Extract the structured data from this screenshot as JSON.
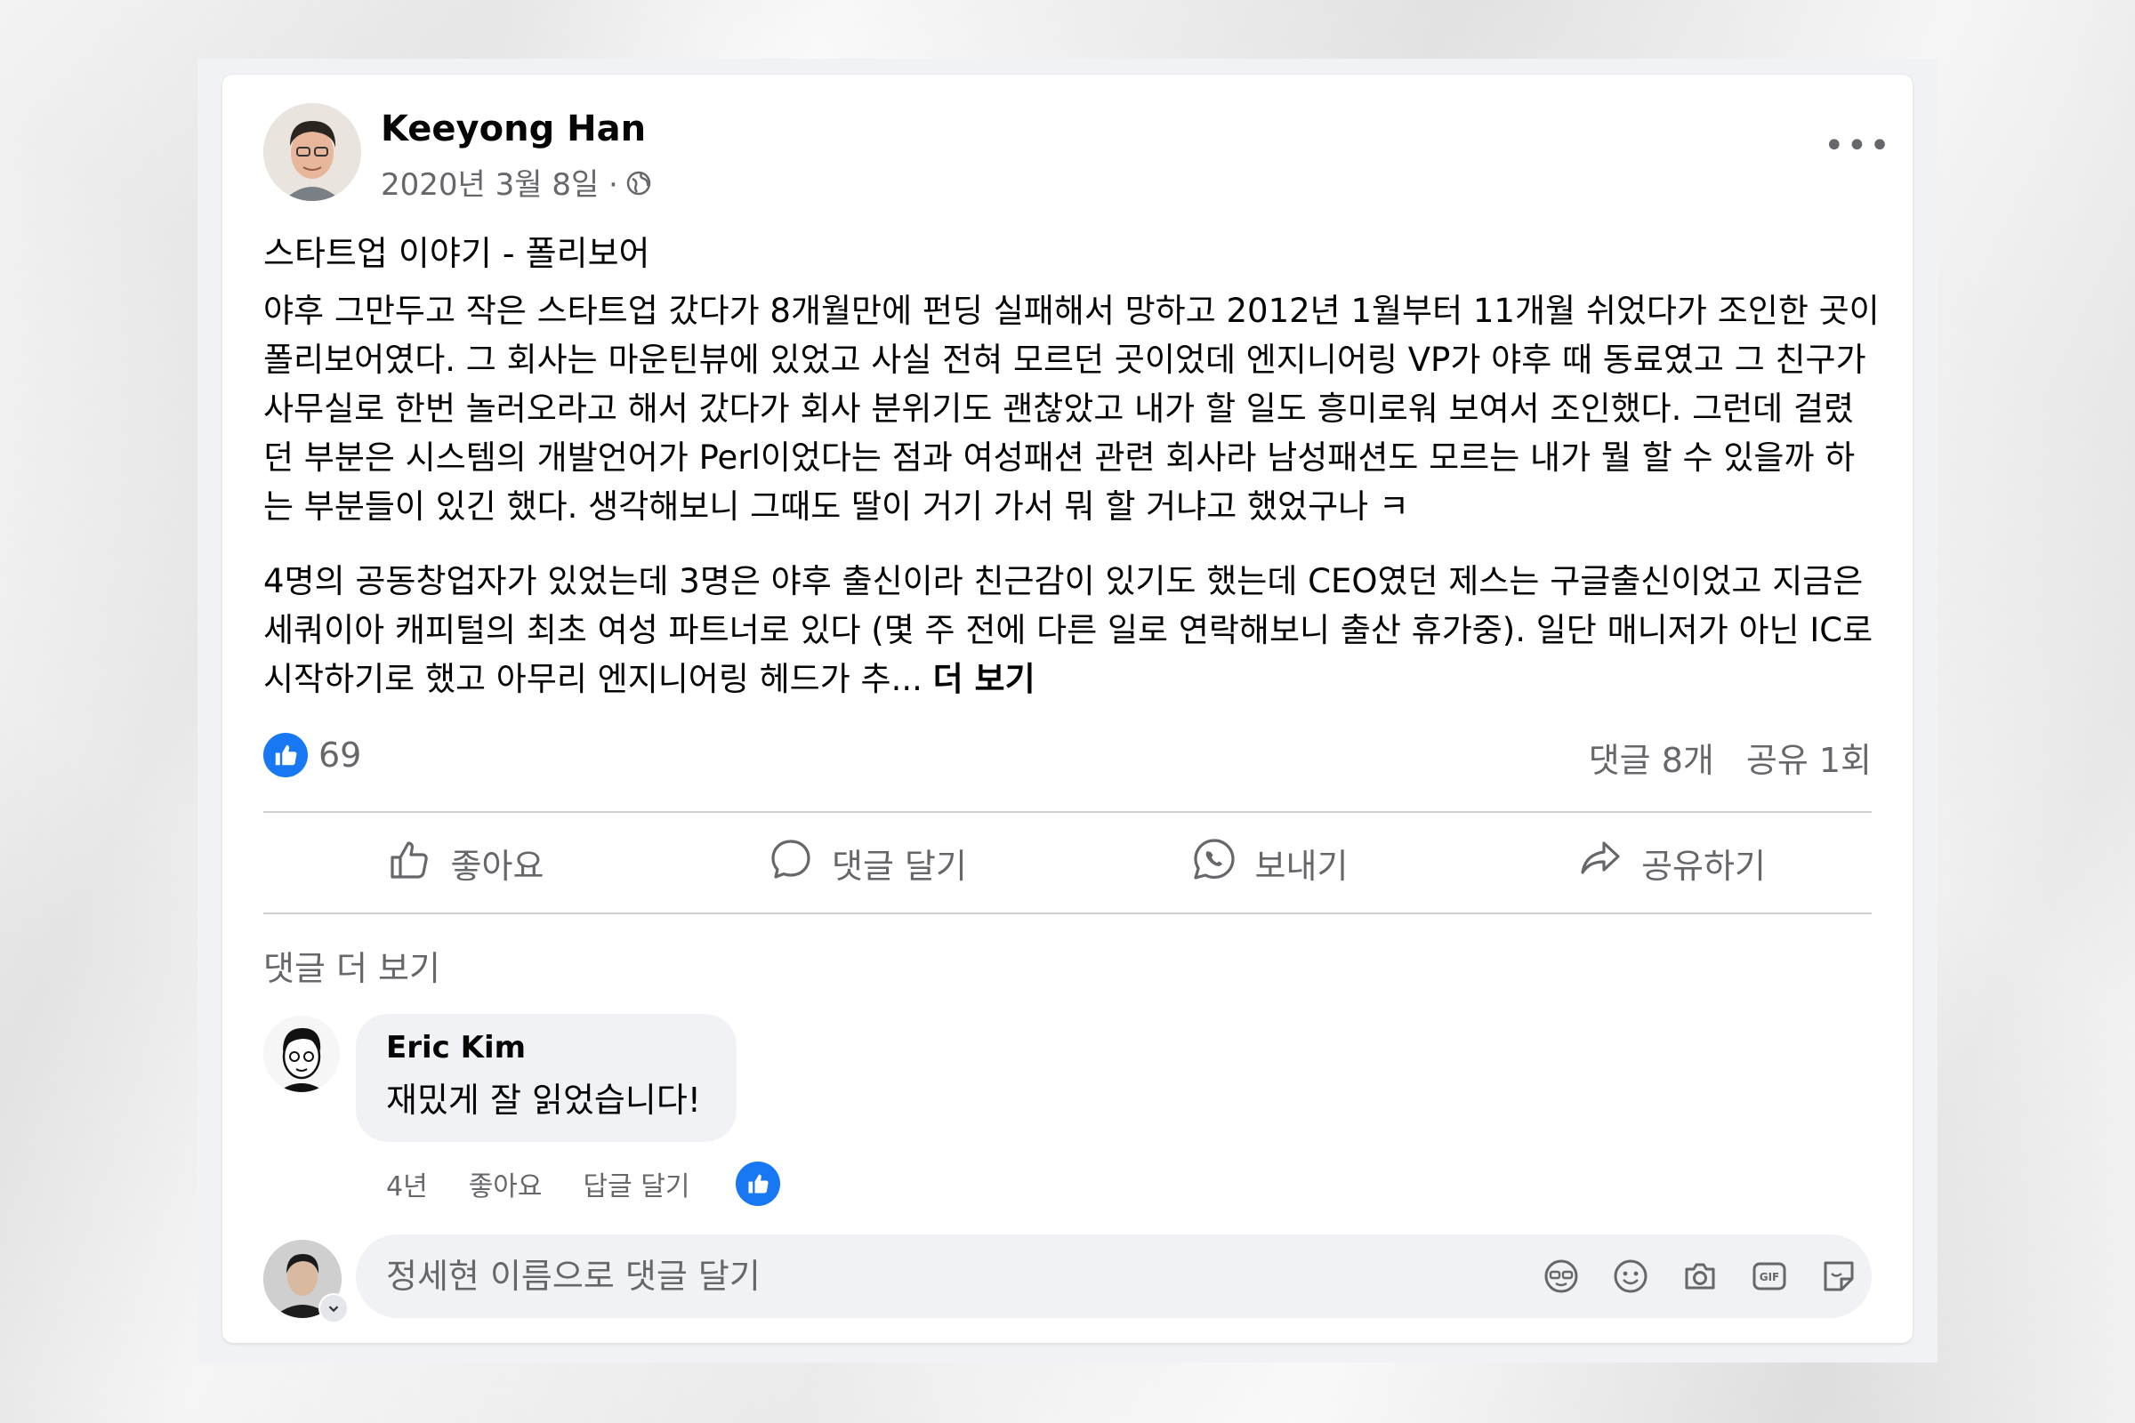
{
  "post": {
    "author": "Keeyong Han",
    "date": "2020년 3월 8일 ·",
    "title": "스타트업 이야기 - 폴리보어",
    "paragraph1": "야후 그만두고 작은 스타트업 갔다가 8개월만에 펀딩 실패해서 망하고 2012년 1월부터 11개월 쉬었다가 조인한 곳이 폴리보어였다. 그 회사는 마운틴뷰에 있었고 사실 전혀 모르던 곳이었데 엔지니어링 VP가 야후 때 동료였고 그 친구가 사무실로 한번 놀러오라고 해서 갔다가 회사 분위기도 괜찮았고 내가 할 일도 흥미로워 보여서 조인했다. 그런데 걸렸던 부분은 시스템의 개발언어가 Perl이었다는 점과 여성패션 관련 회사라 남성패션도 모르는 내가 뭘 할 수 있을까 하는 부분들이 있긴 했다. 생각해보니 그때도 딸이 거기 가서 뭐 할 거냐고 했었구나 ㅋ",
    "paragraph2": "4명의 공동창업자가 있었는데 3명은 야후 출신이라 친근감이 있기도 했는데 CEO였던 제스는 구글출신이었고 지금은 세쿼이아 캐피털의 최초 여성 파트너로 있다 (몇 주 전에 다른 일로 연락해보니 출산 휴가중). 일단 매니저가 아닌 IC로 시작하기로 했고 아무리 엔지니어링 헤드가 추...",
    "see_more": "더 보기",
    "like_count": "69",
    "comments_count": "댓글 8개",
    "shares_count": "공유 1회"
  },
  "actions": {
    "like": "좋아요",
    "comment": "댓글 달기",
    "send": "보내기",
    "share": "공유하기"
  },
  "comments": {
    "more_label": "댓글 더 보기",
    "items": [
      {
        "author": "Eric Kim",
        "text": "재밌게 잘 읽었습니다!",
        "time": "4년",
        "like_label": "좋아요",
        "reply_label": "답글 달기"
      }
    ]
  },
  "composer": {
    "placeholder": "정세현 이름으로 댓글 달기",
    "icons": [
      "avatar-sticker-icon",
      "emoji-icon",
      "camera-icon",
      "gif-icon",
      "sticker-icon"
    ]
  },
  "colors": {
    "accent": "#1877f2",
    "secondary_text": "#65676b",
    "bubble": "#f0f2f5"
  }
}
